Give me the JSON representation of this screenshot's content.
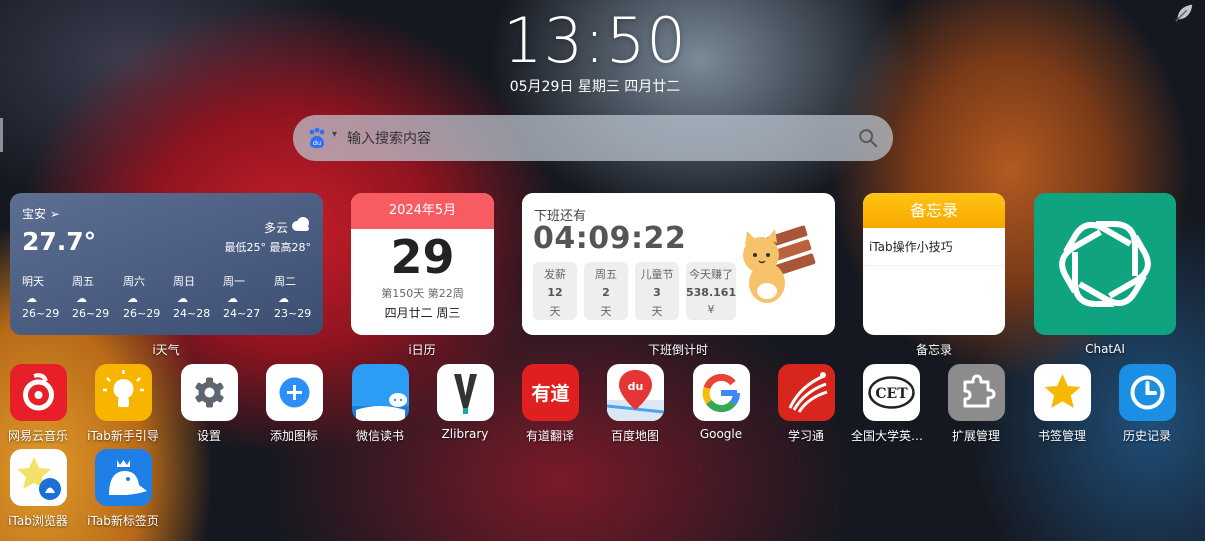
{
  "clock": {
    "time": "13:50",
    "date": "05月29日 星期三 四月廿二"
  },
  "search": {
    "placeholder": "输入搜索内容",
    "engine_text": "du",
    "engine_icon": "baidu-paw-icon"
  },
  "weather": {
    "location": "宝安",
    "temperature": "27.7°",
    "condition": "多云",
    "range": "最低25° 最高28°",
    "forecast": [
      {
        "day": "明天",
        "range": "26~29"
      },
      {
        "day": "周五",
        "range": "26~29"
      },
      {
        "day": "周六",
        "range": "26~29"
      },
      {
        "day": "周日",
        "range": "24~28"
      },
      {
        "day": "周一",
        "range": "24~27"
      },
      {
        "day": "周二",
        "range": "23~29"
      }
    ],
    "label": "i天气"
  },
  "calendar": {
    "header": "2024年5月",
    "day": "29",
    "week": "第150天 第22周",
    "lunar": "四月廿二 周三",
    "label": "i日历"
  },
  "countdown": {
    "title": "下班还有",
    "time": "04:09:22",
    "boxes": [
      {
        "top": "发薪",
        "mid": "12",
        "bot": "天"
      },
      {
        "top": "周五",
        "mid": "2",
        "bot": "天"
      },
      {
        "top": "儿童节",
        "mid": "3",
        "bot": "天"
      },
      {
        "top": "今天赚了",
        "mid": "538.161",
        "bot": "¥"
      }
    ],
    "label": "下班倒计时"
  },
  "memo": {
    "header": "备忘录",
    "items": [
      "iTab操作小技巧"
    ],
    "label": "备忘录"
  },
  "chatgpt": {
    "label": "ChatAI"
  },
  "apps_row1": [
    "网易云音乐",
    "iTab新手引导",
    "设置",
    "添加图标",
    "微信读书",
    "Zlibrary",
    "有道翻译",
    "百度地图",
    "Google",
    "学习通",
    "全国大学英语...",
    "扩展管理",
    "书签管理",
    "历史记录"
  ],
  "apps_row2": [
    "iTab浏览器",
    "iTab新标签页"
  ],
  "icon_text": {
    "youdao": "有道",
    "baidu_map": "du",
    "cet": "CET"
  },
  "colors": {
    "calendar_header": "#f75c62",
    "memo_header": "#f8a800",
    "chatgpt": "#10a37f"
  }
}
